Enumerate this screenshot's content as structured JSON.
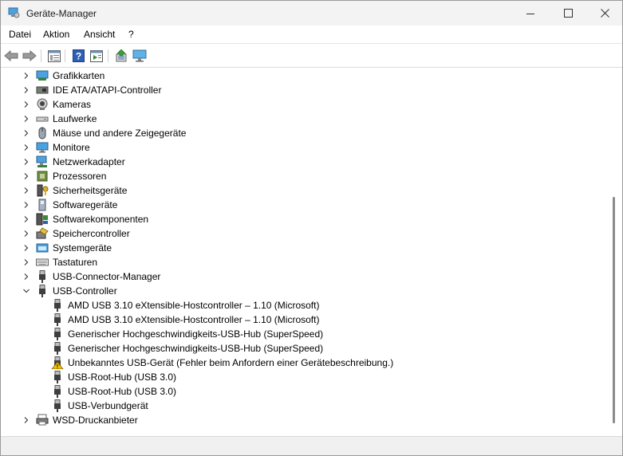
{
  "window": {
    "title": "Geräte-Manager"
  },
  "menu": [
    "Datei",
    "Aktion",
    "Ansicht",
    "?"
  ],
  "toolbar": [
    "back-icon",
    "forward-icon",
    "properties-view-icon",
    "help-icon",
    "details-view-icon",
    "update-driver-icon",
    "monitor-icon"
  ],
  "tree": [
    {
      "label": "Grafikkarten",
      "icon": "display-adapter-icon",
      "level": 0,
      "expanded": false
    },
    {
      "label": "IDE ATA/ATAPI-Controller",
      "icon": "ide-controller-icon",
      "level": 0,
      "expanded": false
    },
    {
      "label": "Kameras",
      "icon": "camera-icon",
      "level": 0,
      "expanded": false
    },
    {
      "label": "Laufwerke",
      "icon": "disk-drive-icon",
      "level": 0,
      "expanded": false
    },
    {
      "label": "Mäuse und andere Zeigegeräte",
      "icon": "mouse-icon",
      "level": 0,
      "expanded": false
    },
    {
      "label": "Monitore",
      "icon": "monitor-icon",
      "level": 0,
      "expanded": false
    },
    {
      "label": "Netzwerkadapter",
      "icon": "network-adapter-icon",
      "level": 0,
      "expanded": false
    },
    {
      "label": "Prozessoren",
      "icon": "processor-icon",
      "level": 0,
      "expanded": false
    },
    {
      "label": "Sicherheitsgeräte",
      "icon": "security-device-icon",
      "level": 0,
      "expanded": false
    },
    {
      "label": "Softwaregeräte",
      "icon": "software-device-icon",
      "level": 0,
      "expanded": false
    },
    {
      "label": "Softwarekomponenten",
      "icon": "software-component-icon",
      "level": 0,
      "expanded": false
    },
    {
      "label": "Speichercontroller",
      "icon": "storage-controller-icon",
      "level": 0,
      "expanded": false
    },
    {
      "label": "Systemgeräte",
      "icon": "system-device-icon",
      "level": 0,
      "expanded": false
    },
    {
      "label": "Tastaturen",
      "icon": "keyboard-icon",
      "level": 0,
      "expanded": false
    },
    {
      "label": "USB-Connector-Manager",
      "icon": "usb-icon",
      "level": 0,
      "expanded": false
    },
    {
      "label": "USB-Controller",
      "icon": "usb-icon",
      "level": 0,
      "expanded": true
    },
    {
      "label": "AMD USB 3.10 eXtensible-Hostcontroller – 1.10 (Microsoft)",
      "icon": "usb-icon",
      "level": 1
    },
    {
      "label": "AMD USB 3.10 eXtensible-Hostcontroller – 1.10 (Microsoft)",
      "icon": "usb-icon",
      "level": 1
    },
    {
      "label": "Generischer Hochgeschwindigkeits-USB-Hub (SuperSpeed)",
      "icon": "usb-icon",
      "level": 1
    },
    {
      "label": "Generischer Hochgeschwindigkeits-USB-Hub (SuperSpeed)",
      "icon": "usb-icon",
      "level": 1
    },
    {
      "label": "Unbekanntes USB-Gerät (Fehler beim Anfordern einer Gerätebeschreibung.)",
      "icon": "usb-warning-icon",
      "level": 1
    },
    {
      "label": "USB-Root-Hub (USB 3.0)",
      "icon": "usb-icon",
      "level": 1
    },
    {
      "label": "USB-Root-Hub (USB 3.0)",
      "icon": "usb-icon",
      "level": 1
    },
    {
      "label": "USB-Verbundgerät",
      "icon": "usb-icon",
      "level": 1
    },
    {
      "label": "WSD-Druckanbieter",
      "icon": "printer-icon",
      "level": 0,
      "expanded": false
    }
  ]
}
